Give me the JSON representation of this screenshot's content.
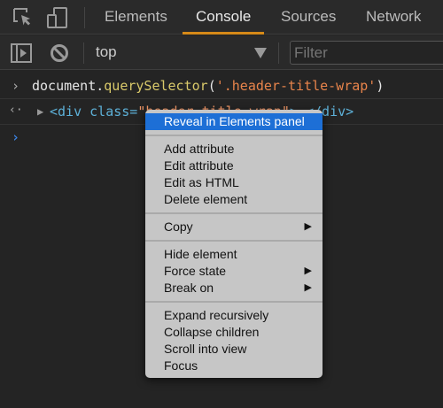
{
  "tabs": [
    {
      "label": "Elements"
    },
    {
      "label": "Console",
      "active": true
    },
    {
      "label": "Sources"
    },
    {
      "label": "Network"
    }
  ],
  "toolbar": {
    "context": "top",
    "filter_placeholder": "Filter"
  },
  "console": {
    "input": {
      "obj": "document.",
      "method": "querySelector",
      "open": "(",
      "arg": "'.header-title-wrap'",
      "close": ")"
    },
    "output": {
      "open": "<div class=",
      "attr": "\"header-title-wrap\"",
      "rest": ">…</div>"
    }
  },
  "menu": {
    "groups": [
      [
        {
          "label": "Reveal in Elements panel",
          "highlighted": true
        }
      ],
      [
        {
          "label": "Add attribute"
        },
        {
          "label": "Edit attribute"
        },
        {
          "label": "Edit as HTML"
        },
        {
          "label": "Delete element"
        }
      ],
      [
        {
          "label": "Copy",
          "submenu": true
        }
      ],
      [
        {
          "label": "Hide element"
        },
        {
          "label": "Force state",
          "submenu": true
        },
        {
          "label": "Break on",
          "submenu": true
        }
      ],
      [
        {
          "label": "Expand recursively"
        },
        {
          "label": "Collapse children"
        },
        {
          "label": "Scroll into view"
        },
        {
          "label": "Focus"
        }
      ]
    ]
  },
  "colors": {
    "accent": "#d68a18",
    "highlight": "#1d6fd6",
    "method": "#d9c96a",
    "string": "#e8844b",
    "tag": "#5db0d7"
  }
}
